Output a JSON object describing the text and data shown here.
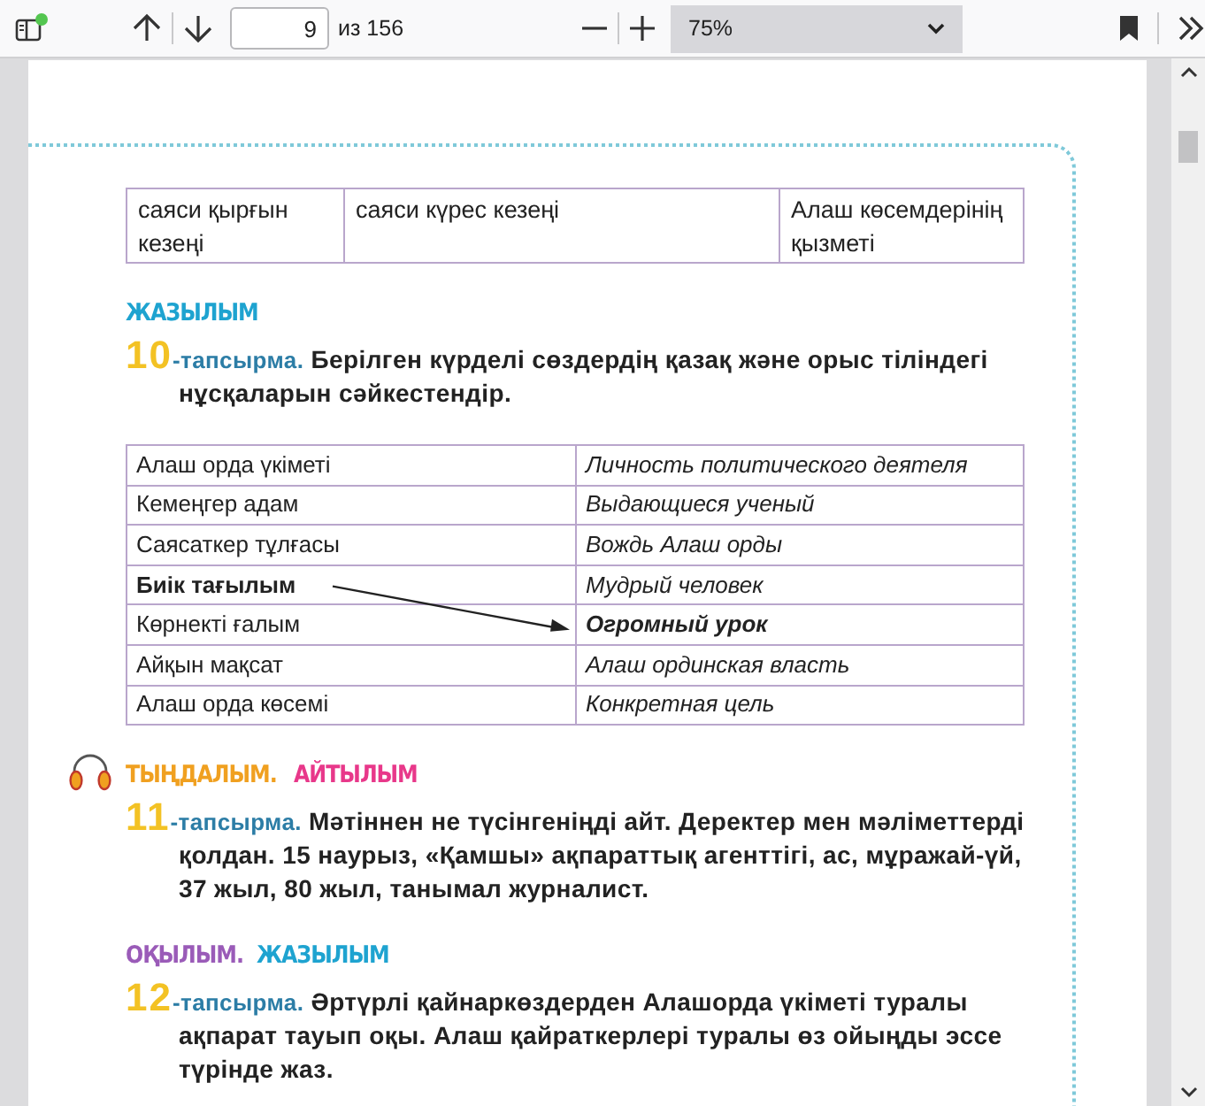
{
  "toolbar": {
    "page_input": "9",
    "page_count": "из 156",
    "zoom": "75%"
  },
  "blocks": [
    {
      "kind": "table",
      "rows": [
        [
          "саяси қырғын кезеңі",
          "саяси күрес кезеңі",
          "Алаш көсемдерінің қызметі"
        ]
      ]
    },
    {
      "kind": "heading",
      "parts": [
        {
          "text": "ЖАЗЫЛЫМ",
          "color": "#1ea3d0"
        }
      ]
    },
    {
      "kind": "task",
      "number": "10",
      "label": "-тапсырма.",
      "text": "Берілген күрделі сөздердің қазақ және орыс тіліндегі нұсқаларын сәйкестендір."
    },
    {
      "kind": "match",
      "rows": [
        {
          "left": "Алаш орда үкіметі",
          "left_bold": false,
          "right": "Личность политического деятеля",
          "right_bold": false,
          "arrow_to_next_row": false
        },
        {
          "left": "Кемеңгер адам",
          "left_bold": false,
          "right": "Выдающиеся ученый",
          "right_bold": false,
          "arrow_to_next_row": false
        },
        {
          "left": "Саясаткер тұлғасы",
          "left_bold": false,
          "right": "Вождь Алаш орды",
          "right_bold": false,
          "arrow_to_next_row": false
        },
        {
          "left": "Биік тағылым",
          "left_bold": true,
          "right": "Мудрый человек",
          "right_bold": false,
          "arrow_to_next_row": true
        },
        {
          "left": "Көрнекті ғалым",
          "left_bold": false,
          "right": "Огромный урок",
          "right_bold": true,
          "arrow_to_next_row": false
        },
        {
          "left": "Айқын мақсат",
          "left_bold": false,
          "right": "Алаш ординская власть",
          "right_bold": false,
          "arrow_to_next_row": false
        },
        {
          "left": "Алаш орда көсемі",
          "left_bold": false,
          "right": "Конкретная цель",
          "right_bold": false,
          "arrow_to_next_row": false
        }
      ]
    },
    {
      "kind": "heading",
      "audio": true,
      "parts": [
        {
          "text": "ТЫҢДАЛЫМ.",
          "color": "#f0a020"
        },
        {
          "text": "АЙТЫЛЫМ",
          "color": "#e8388a"
        }
      ]
    },
    {
      "kind": "task",
      "number": "11",
      "label": "-тапсырма.",
      "text": "Мәтіннен  не түсінгеніңді айт. Деректер мен мәліметтерді қолдан. 15 наурыз, «Қамшы» ақпараттық агенттігі, ас, мұражай-үй, 37 жыл, 80 жыл, танымал журналист."
    },
    {
      "kind": "heading",
      "parts": [
        {
          "text": "ОҚЫЛЫМ.",
          "color": "#9a5bb8"
        },
        {
          "text": "ЖАЗЫЛЫМ",
          "color": "#1ea3d0"
        }
      ]
    },
    {
      "kind": "task",
      "number": "12",
      "label": "-тапсырма.",
      "text": "Әртүрлі қайнаркөздерден Алашорда үкіметі туралы ақпарат тауып оқы.  Алаш қайраткерлері туралы өз ойыңды эссе түрінде жаз."
    }
  ]
}
